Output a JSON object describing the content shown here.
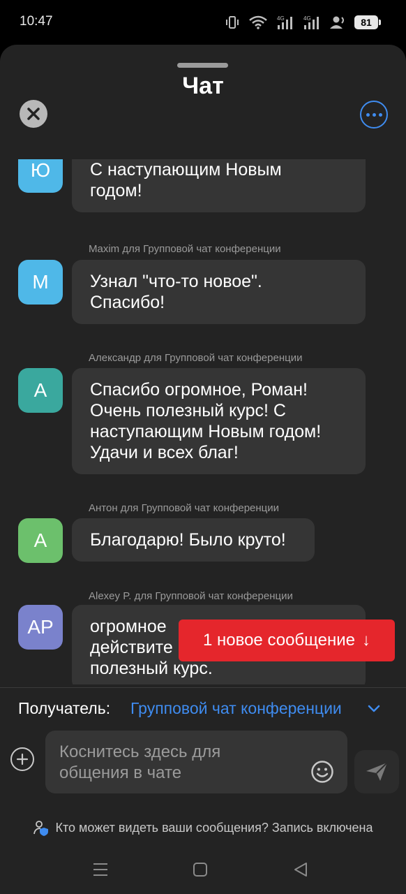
{
  "status_bar": {
    "time": "10:47",
    "battery": "81",
    "icons": [
      "vibrate-icon",
      "wifi-icon",
      "signal-4g-icon",
      "signal-4g-icon",
      "hotspot-user-icon",
      "battery-icon"
    ]
  },
  "header": {
    "title": "Чат",
    "close_icon": "close-icon",
    "more_icon": "more-options-icon"
  },
  "messages": [
    {
      "sender": "",
      "avatar": "Ю",
      "avatar_color": "#4fb8e8",
      "lines": [
        "С наступающим Новым",
        "годом!"
      ]
    },
    {
      "sender": "Maxim для Групповой чат конференции",
      "avatar": "M",
      "avatar_color": "#4fb8e8",
      "lines": [
        "Узнал \"что-то новое\".",
        "Спасибо!"
      ]
    },
    {
      "sender": "Александр для Групповой чат конференции",
      "avatar": "А",
      "avatar_color": "#3aa89e",
      "lines": [
        "Спасибо огромное, Роман!",
        "Очень полезный курс! С",
        "наступающим Новым годом!",
        "Удачи и всех благ!"
      ]
    },
    {
      "sender": "Антон для Групповой чат конференции",
      "avatar": "А",
      "avatar_color": "#6cc06c",
      "lines": [
        "Благодарю! Было круто!"
      ]
    },
    {
      "sender": "Alexey P. для Групповой чат конференции",
      "avatar": "AP",
      "avatar_color": "#7a82cc",
      "lines": [
        "огромное",
        "действите",
        "полезный курс."
      ]
    }
  ],
  "new_message_toast": {
    "label": "1 новое сообщение",
    "arrow": "↓",
    "color": "#e5262c"
  },
  "recipient": {
    "label": "Получатель:",
    "value": "Групповой чат конференции"
  },
  "composer": {
    "placeholder_line1": "Коснитесь здесь для",
    "placeholder_line2": "общения в чате"
  },
  "privacy": {
    "text": "Кто может видеть ваши сообщения? Запись включена"
  },
  "colors": {
    "accent": "#3f8cf0",
    "sheet_background": "#232323",
    "bubble": "#353535"
  }
}
